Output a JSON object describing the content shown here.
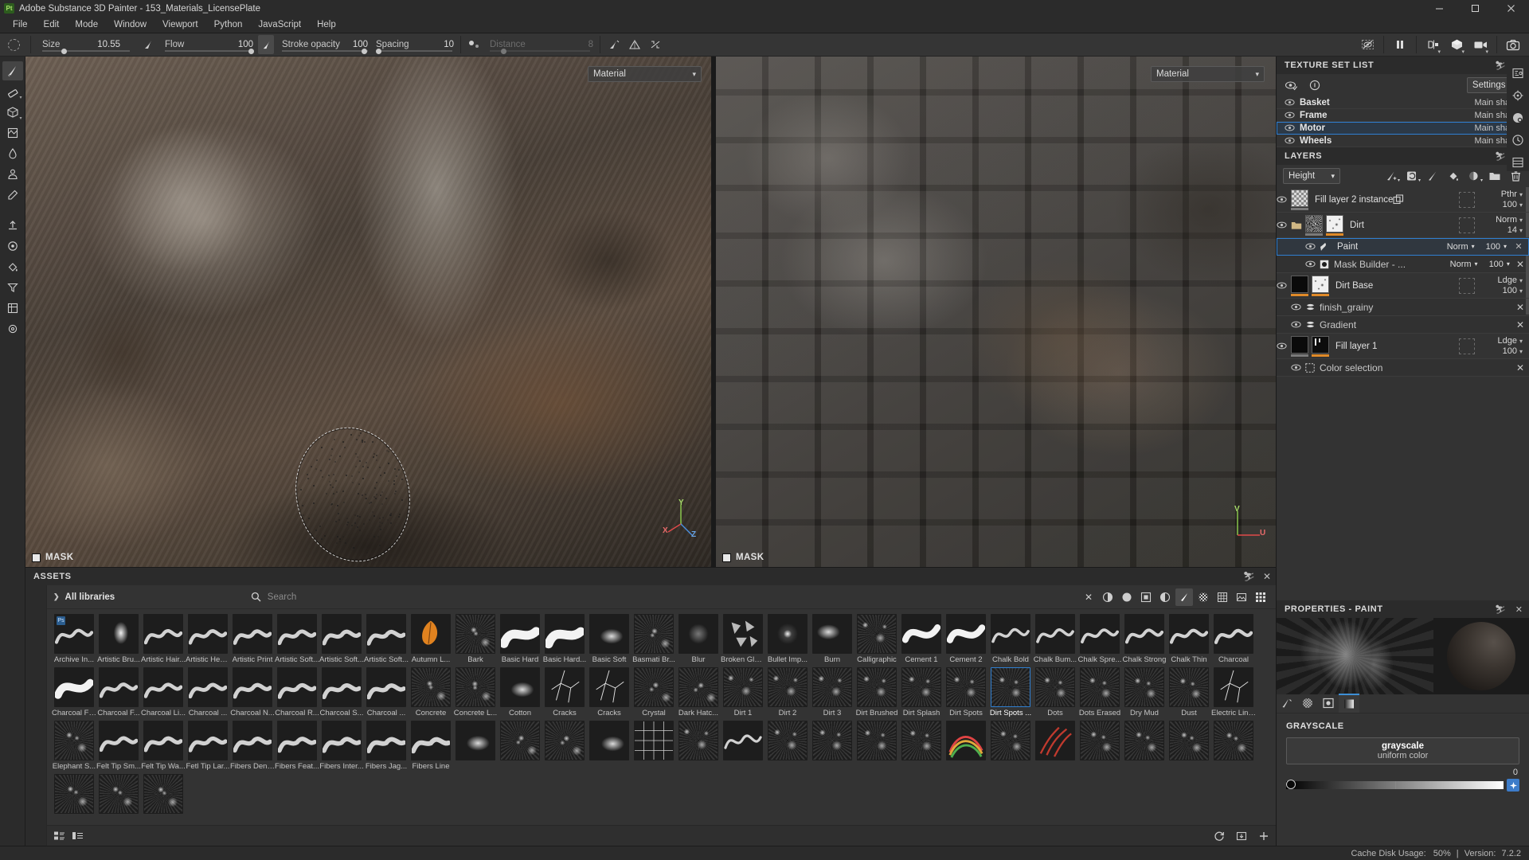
{
  "window": {
    "app_icon": "substance-painter-logo",
    "title": "Adobe Substance 3D Painter - 153_Materials_LicensePlate",
    "minimize": "–",
    "maximize": "❐",
    "close": "✕"
  },
  "menubar": {
    "items": [
      "File",
      "Edit",
      "Mode",
      "Window",
      "Viewport",
      "Python",
      "JavaScript",
      "Help"
    ]
  },
  "toolbar": {
    "params": [
      {
        "label": "Size",
        "value": "10.55",
        "fill": 0.22
      },
      {
        "label": "Flow",
        "value": "100",
        "fill": 1.0
      },
      {
        "label": "Stroke opacity",
        "value": "100",
        "fill": 1.0
      },
      {
        "label": "Spacing",
        "value": "10",
        "fill": 0.1
      },
      {
        "label": "Distance",
        "value": "8",
        "fill": 0.12,
        "disabled": true
      }
    ],
    "right_tools": [
      "hide-symmetry-icon",
      "pause-icon",
      "mirror-icon",
      "3d-view-icon",
      "camera-view-icon",
      "screenshot-icon"
    ]
  },
  "left_tools": [
    "paint-brush-tool",
    "eraser-tool",
    "projection-tool",
    "polygon-fill-tool",
    "smudge-tool",
    "clone-tool",
    "material-picker-tool",
    "export-tool",
    "bake-tool",
    "fill-tool",
    "filter-tool",
    "generator-tool",
    "settings-tool"
  ],
  "viewports": {
    "left": {
      "material_dropdown": "Material",
      "badge": "MASK"
    },
    "right": {
      "material_dropdown": "Material",
      "badge": "MASK"
    },
    "axis_labels": {
      "x": "X",
      "y": "Y",
      "z": "Z",
      "u": "U",
      "v": "V"
    }
  },
  "assets": {
    "title": "ASSETS",
    "maximize_icon": "maximize-icon",
    "close_icon": "close-icon",
    "library_label": "All libraries",
    "search": {
      "placeholder": "Search",
      "value": ""
    },
    "filters": [
      "clear-filter-icon",
      "materials-filter-icon",
      "smart-materials-filter-icon",
      "masks-filter-icon",
      "smart-masks-filter-icon",
      "brushes-filter-icon",
      "alphas-filter-icon",
      "textures-filter-icon",
      "environments-filter-icon",
      "grid-view-icon"
    ],
    "footer": {
      "left_icons": [
        "list-view-icon",
        "detail-view-icon"
      ],
      "right_icons": [
        "refresh-icon",
        "import-icon",
        "add-icon"
      ]
    },
    "items": [
      {
        "name": "Archive In...",
        "badge": "Ps",
        "art": "stroke-wave"
      },
      {
        "name": "Artistic Bru...",
        "art": "stroke-blob"
      },
      {
        "name": "Artistic Hair...",
        "art": "stroke-wave"
      },
      {
        "name": "Artistic Hea...",
        "art": "stroke-wave"
      },
      {
        "name": "Artistic Print",
        "art": "stroke-wave"
      },
      {
        "name": "Artistic Soft...",
        "art": "stroke-wave"
      },
      {
        "name": "Artistic Soft...",
        "art": "stroke-wave"
      },
      {
        "name": "Artistic Soft...",
        "art": "stroke-wave"
      },
      {
        "name": "Autumn L...",
        "art": "leaf"
      },
      {
        "name": "Bark",
        "art": "noise"
      },
      {
        "name": "Basic Hard",
        "art": "stroke-thick"
      },
      {
        "name": "Basic Hard...",
        "art": "stroke-thick"
      },
      {
        "name": "Basic Soft",
        "art": "stroke-soft"
      },
      {
        "name": "Basmati Br...",
        "art": "noise"
      },
      {
        "name": "Blur",
        "art": "blur"
      },
      {
        "name": "Broken Glass",
        "art": "shards"
      },
      {
        "name": "Bullet Imp...",
        "art": "impact"
      },
      {
        "name": "Burn",
        "art": "stroke-soft"
      },
      {
        "name": "Calligraphic",
        "art": "noise"
      },
      {
        "name": "Cement 1",
        "art": "stroke-thick"
      },
      {
        "name": "Cement 2",
        "art": "stroke-thick"
      },
      {
        "name": "Chalk Bold",
        "art": "stroke-wave"
      },
      {
        "name": "Chalk Bum...",
        "art": "stroke-wave"
      },
      {
        "name": "Chalk Spre...",
        "art": "stroke-wave"
      },
      {
        "name": "Chalk Strong",
        "art": "stroke-wave"
      },
      {
        "name": "Chalk Thin",
        "art": "stroke-wave"
      },
      {
        "name": "Charcoal",
        "art": "stroke-wave"
      },
      {
        "name": "Charcoal Fi...",
        "art": "stroke-thick"
      },
      {
        "name": "Charcoal F...",
        "art": "stroke-wave"
      },
      {
        "name": "Charcoal Li...",
        "art": "stroke-wave"
      },
      {
        "name": "Charcoal ...",
        "art": "stroke-wave"
      },
      {
        "name": "Charcoal N...",
        "art": "stroke-wave"
      },
      {
        "name": "Charcoal R...",
        "art": "stroke-wave"
      },
      {
        "name": "Charcoal S...",
        "art": "stroke-wave"
      },
      {
        "name": "Charcoal ...",
        "art": "stroke-wave"
      },
      {
        "name": "Concrete",
        "art": "noise"
      },
      {
        "name": "Concrete L...",
        "art": "noise"
      },
      {
        "name": "Cotton",
        "art": "stroke-soft"
      },
      {
        "name": "Cracks",
        "art": "cracks"
      },
      {
        "name": "Cracks",
        "art": "cracks"
      },
      {
        "name": "Crystal",
        "art": "noise"
      },
      {
        "name": "Dark Hatc...",
        "art": "noise"
      },
      {
        "name": "Dirt 1",
        "art": "noise"
      },
      {
        "name": "Dirt 2",
        "art": "noise"
      },
      {
        "name": "Dirt 3",
        "art": "noise"
      },
      {
        "name": "Dirt Brushed",
        "art": "noise"
      },
      {
        "name": "Dirt Splash",
        "art": "noise"
      },
      {
        "name": "Dirt Spots",
        "art": "noise"
      },
      {
        "name": "Dirt Spots ...",
        "art": "noise",
        "selected": true
      },
      {
        "name": "Dots",
        "art": "noise"
      },
      {
        "name": "Dots Erased",
        "art": "noise"
      },
      {
        "name": "Dry Mud",
        "art": "noise"
      },
      {
        "name": "Dust",
        "art": "noise"
      },
      {
        "name": "Electric Lines",
        "art": "cracks"
      },
      {
        "name": "Elephant S...",
        "art": "noise"
      },
      {
        "name": "Felt Tip Sm...",
        "art": "stroke-wave"
      },
      {
        "name": "Felt Tip Wa...",
        "art": "stroke-wave"
      },
      {
        "name": "Fetl Tip Lar...",
        "art": "stroke-wave"
      },
      {
        "name": "Fibers Dense",
        "art": "stroke-wave"
      },
      {
        "name": "Fibers Feat...",
        "art": "stroke-wave"
      },
      {
        "name": "Fibers Inter...",
        "art": "stroke-wave"
      },
      {
        "name": "Fibers Jag...",
        "art": "stroke-wave"
      },
      {
        "name": "Fibers Line",
        "art": "stroke-wave"
      },
      {
        "name": "",
        "art": "stroke-soft"
      },
      {
        "name": "",
        "art": "noise"
      },
      {
        "name": "",
        "art": "noise"
      },
      {
        "name": "",
        "art": "stroke-soft"
      },
      {
        "name": "",
        "art": "grid"
      },
      {
        "name": "",
        "art": "noise"
      },
      {
        "name": "",
        "art": "stroke-wave"
      },
      {
        "name": "",
        "art": "noise"
      },
      {
        "name": "",
        "art": "noise"
      },
      {
        "name": "",
        "art": "noise"
      },
      {
        "name": "",
        "art": "noise"
      },
      {
        "name": "",
        "art": "rainbow"
      },
      {
        "name": "",
        "art": "noise"
      },
      {
        "name": "",
        "art": "red"
      },
      {
        "name": "",
        "art": "noise"
      },
      {
        "name": "",
        "art": "noise"
      },
      {
        "name": "",
        "art": "noise"
      },
      {
        "name": "",
        "art": "noise"
      },
      {
        "name": "",
        "art": "noise"
      },
      {
        "name": "",
        "art": "noise"
      },
      {
        "name": "",
        "art": "noise"
      }
    ]
  },
  "texture_set_list": {
    "title": "TEXTURE SET LIST",
    "maximize_icon": "maximize-icon",
    "close_icon": "close-icon",
    "tools": [
      "visibility-toggle-icon",
      "info-icon"
    ],
    "settings_label": "Settings",
    "settings_chevron": "∨",
    "rows": [
      {
        "name": "Basket",
        "shader": "Main shader",
        "selected": false
      },
      {
        "name": "Frame",
        "shader": "Main shader",
        "selected": false
      },
      {
        "name": "Motor",
        "shader": "Main shader",
        "selected": true
      },
      {
        "name": "Wheels",
        "shader": "Main shader",
        "selected": false
      }
    ]
  },
  "layers": {
    "title": "LAYERS",
    "maximize_icon": "maximize-icon",
    "close_icon": "close-icon",
    "channel": "Height",
    "channel_chevron": "∨",
    "tools": [
      "add-effect-icon",
      "add-fill-icon",
      "add-paint-layer-icon",
      "add-fill-layer-icon",
      "add-mask-icon",
      "add-folder-icon",
      "delete-layer-icon"
    ],
    "rows": [
      {
        "type": "layer",
        "name": "Fill layer 2 instance",
        "blend": "Pthr",
        "opacity": "100",
        "thumbs": [
          "checker"
        ],
        "bars": [
          "gr"
        ],
        "instance_icon": "instance-icon",
        "has_mask_slot": true
      },
      {
        "type": "folder",
        "name": "Dirt",
        "blend": "Norm",
        "opacity": "14",
        "thumbs": [
          "noiseA",
          "noiseB"
        ],
        "bars": [
          "gr",
          "or"
        ],
        "has_mask_slot": true
      },
      {
        "type": "effect",
        "name": "Paint",
        "blend": "Norm",
        "opacity": "100",
        "icon": "paint-brush-icon",
        "selected": true,
        "indent": 2
      },
      {
        "type": "effect",
        "name": "Mask Builder - ...",
        "blend": "Norm",
        "opacity": "100",
        "icon": "mask-builder-icon",
        "indent": 2
      },
      {
        "type": "layer",
        "name": "Dirt Base",
        "blend": "Ldge",
        "opacity": "100",
        "thumbs": [
          "black",
          "noiseB"
        ],
        "bars": [
          "or",
          "or"
        ],
        "has_mask_slot": true
      },
      {
        "type": "effect",
        "name": "finish_grainy",
        "icon": "filter-icon",
        "indent": 1
      },
      {
        "type": "effect",
        "name": "Gradient",
        "icon": "filter-icon",
        "indent": 1
      },
      {
        "type": "layer",
        "name": "Fill layer 1",
        "blend": "Ldge",
        "opacity": "100",
        "thumbs": [
          "black",
          "maskbars"
        ],
        "bars": [
          "gr",
          "or"
        ],
        "has_mask_slot": true
      },
      {
        "type": "effect",
        "name": "Color selection",
        "icon": "color-selection-icon",
        "indent": 1
      }
    ]
  },
  "properties": {
    "title": "PROPERTIES - PAINT",
    "maximize_icon": "maximize-icon",
    "close_icon": "close-icon",
    "tabs": [
      {
        "icon": "stroke-tab-icon",
        "active": false
      },
      {
        "icon": "alpha-tab-icon",
        "active": false
      },
      {
        "icon": "brush-tab-icon",
        "active": false
      },
      {
        "icon": "material-tab-icon",
        "active": true
      }
    ],
    "grayscale": {
      "section_title": "GRAYSCALE",
      "mode_title": "grayscale",
      "mode_sub": "uniform color",
      "value": "0"
    }
  },
  "right_strip": [
    "display-settings-icon",
    "shader-settings-icon",
    "texture-set-settings-icon",
    "history-icon",
    "shelf-icon"
  ],
  "statusbar": {
    "cache_label": "Cache Disk Usage:",
    "cache_value": "50%",
    "separator": "|",
    "version_label": "Version:",
    "version_value": "7.2.2"
  },
  "colors": {
    "accent_blue": "#2f7fd1",
    "accent_orange": "#e08a28",
    "panel_bg": "#333333",
    "chrome_bg": "#2b2b2b"
  }
}
